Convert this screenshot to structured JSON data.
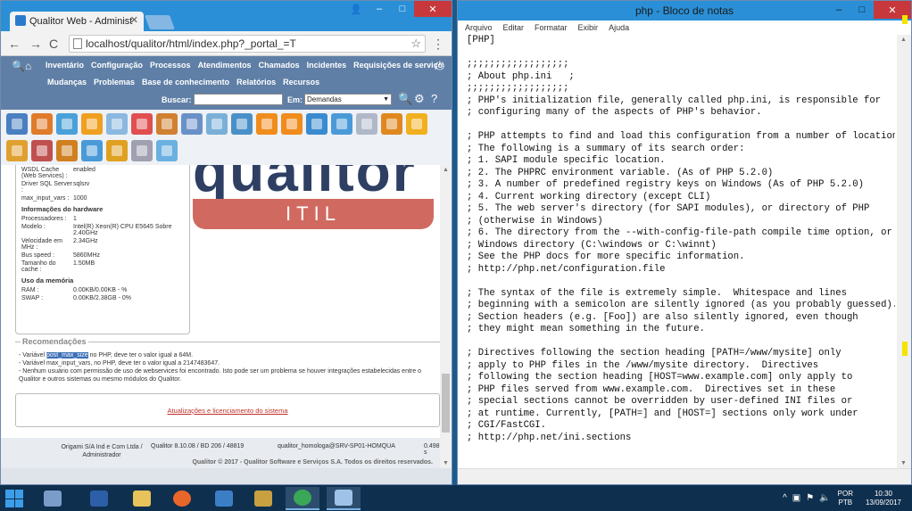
{
  "chrome": {
    "tab_title": "Qualitor Web - Administ",
    "tab_close": "✕",
    "url": "localhost/qualitor/html/index.php?_portal_=T",
    "back": "←",
    "forward": "→",
    "reload": "C",
    "star": "☆",
    "menu": "⋮",
    "minimize": "–",
    "maximize": "□",
    "close": "✕"
  },
  "qualitor": {
    "nav1": [
      "Inventário",
      "Configuração",
      "Processos",
      "Atendimentos",
      "Chamados",
      "Incidentes",
      "Requisições de serviço"
    ],
    "nav2": [
      "Mudanças",
      "Problemas",
      "Base de conhecimento",
      "Relatórios",
      "Recursos"
    ],
    "search_label": "Buscar:",
    "em_label": "Em:",
    "em_value": "Demandas",
    "toolbar_colors_row1": [
      "#4a7fc1",
      "#e07b2a",
      "#4aa0d8",
      "#f0a020",
      "#8bb8e0",
      "#e05050",
      "#d08030",
      "#6a90c8",
      "#7ab0d8",
      "#4a90c8",
      "#f08c1c",
      "#f08c1c",
      "#3a8ad0",
      "#4a9ad8",
      "#b0b8c8",
      "#e08820",
      "#f0b020"
    ],
    "toolbar_colors_row2": [
      "#e0a030",
      "#c05050",
      "#d08020",
      "#4a9ad8",
      "#e0a020",
      "#a0a0b0",
      "#6ab0e0"
    ],
    "info": {
      "wsdl_k": "WSDL Cache (Web Services) :",
      "wsdl_v": "enabled",
      "driver_k": "Driver SQL Server :",
      "driver_v": "sqlsrv",
      "maxvars_k": "max_input_vars :",
      "maxvars_v": "1000",
      "hw_title": "Informações do hardware",
      "proc_k": "Processadores :",
      "proc_v": "1",
      "model_k": "Modelo :",
      "model_v": "Intel(R) Xeon(R) CPU E5645 Sobre 2.40GHz",
      "speed_k": "Velocidade em MHz :",
      "speed_v": "2.34GHz",
      "bus_k": "Bus speed :",
      "bus_v": "5860MHz",
      "cache_k": "Tamanho do cache :",
      "cache_v": "1.50MB",
      "mem_title": "Uso da memória",
      "ram_k": "RAM :",
      "ram_v": "0.00KB/0.00KB - %",
      "swap_k": "SWAP :",
      "swap_v": "0.00KB/2.38GB - 0%"
    },
    "logo_text": "qualitor",
    "itil": "ITIL",
    "rec_title": "Recomendações",
    "rec_line1_pre": "- Variável ",
    "rec_line1_hl": "post_max_size",
    "rec_line1_post": " no PHP, deve ter o valor igual a 64M.",
    "rec_line2": "- Variável max_input_vars, no PHP, deve ter o valor igual a 2147483647.",
    "rec_line3": "- Nenhum usuário com permissão de uso de webservices foi encontrado. Isto pode ser um problema se houver integrações estabelecidas entre o Qualitor e outros sistemas ou mesmo módulos do Qualitor.",
    "update_link": "Atualizações e licenciamento do sistema",
    "footer": {
      "origami": "Origami S/A Ind e Com Ltda / Administrador",
      "version": "Qualitor 8.10.08 / BD 206 / 48819",
      "server": "qualitor_homologa@SRV-SP01-HOMQUA",
      "num": "0.498 s",
      "copyright": "Qualitor © 2017 - Qualitor Software e Serviços S.A. Todos os direitos reservados."
    }
  },
  "notepad": {
    "title": "php - Bloco de notas",
    "menu": [
      "Arquivo",
      "Editar",
      "Formatar",
      "Exibir",
      "Ajuda"
    ],
    "minimize": "–",
    "maximize": "□",
    "close": "✕",
    "text": "[PHP]\n\n;;;;;;;;;;;;;;;;;;\n; About php.ini   ;\n;;;;;;;;;;;;;;;;;;\n; PHP's initialization file, generally called php.ini, is responsible for\n; configuring many of the aspects of PHP's behavior.\n\n; PHP attempts to find and load this configuration from a number of locations.\n; The following is a summary of its search order:\n; 1. SAPI module specific location.\n; 2. The PHPRC environment variable. (As of PHP 5.2.0)\n; 3. A number of predefined registry keys on Windows (As of PHP 5.2.0)\n; 4. Current working directory (except CLI)\n; 5. The web server's directory (for SAPI modules), or directory of PHP\n; (otherwise in Windows)\n; 6. The directory from the --with-config-file-path compile time option, or the\n; Windows directory (C:\\windows or C:\\winnt)\n; See the PHP docs for more specific information.\n; http://php.net/configuration.file\n\n; The syntax of the file is extremely simple.  Whitespace and lines\n; beginning with a semicolon are silently ignored (as you probably guessed).\n; Section headers (e.g. [Foo]) are also silently ignored, even though\n; they might mean something in the future.\n\n; Directives following the section heading [PATH=/www/mysite] only\n; apply to PHP files in the /www/mysite directory.  Directives\n; following the section heading [HOST=www.example.com] only apply to\n; PHP files served from www.example.com.  Directives set in these\n; special sections cannot be overridden by user-defined INI files or\n; at runtime. Currently, [PATH=] and [HOST=] sections only work under\n; CGI/FastCGI.\n; http://php.net/ini.sections"
  },
  "taskbar": {
    "lang": "POR",
    "layout": "PTB",
    "time": "10:30",
    "date": "13/09/2017",
    "apps": [
      "server-manager",
      "powershell",
      "file-explorer",
      "firefox",
      "app-blue",
      "app-tools",
      "chrome",
      "notepad"
    ]
  }
}
